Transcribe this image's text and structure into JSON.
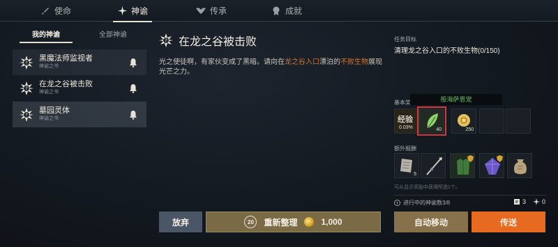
{
  "top_tabs": [
    {
      "label": "使命",
      "icon": "sword-icon"
    },
    {
      "label": "神谕",
      "icon": "compass-star-icon"
    },
    {
      "label": "传承",
      "icon": "wings-icon"
    },
    {
      "label": "成就",
      "icon": "medal-icon"
    }
  ],
  "sub_tabs": {
    "mine": "我的神谕",
    "all": "全部神谕"
  },
  "quests": [
    {
      "title": "黑魔法师监视者",
      "subtitle": "神谕之书"
    },
    {
      "title": "在龙之谷被击败",
      "subtitle": "神谕之书"
    },
    {
      "title": "墓园灵体",
      "subtitle": "神谕之书"
    }
  ],
  "main": {
    "title": "在龙之谷被击败",
    "desc_part1": "光之使徒啊，有家伙变成了黑暗。请向在",
    "desc_highlight1": "龙之谷入口",
    "desc_part2": "漂泊的",
    "desc_highlight2": "不败生物",
    "desc_part3": "展现光芒之力。"
  },
  "goal": {
    "label": "任务目标",
    "text": "清理龙之谷入口的不败生物(0/150)"
  },
  "rewards": {
    "basic_label": "基本奖",
    "tooltip": "般海萨恩宠",
    "exp_label": "经验",
    "exp_value": "0.03%",
    "item_count": "40",
    "gold_count": "250",
    "extra_label": "额外报酬",
    "extra_count": "5",
    "hint": "可从显示奖励中获得所选1个。"
  },
  "progress": {
    "text": "进行中的神谕数3/8",
    "count_a": "3",
    "count_b": "0"
  },
  "buttons": {
    "give_up": "放弃",
    "reset": "重新整理",
    "reset_badge": "20",
    "reset_cost": "1,000",
    "auto_move": "自动移动",
    "teleport": "传送"
  },
  "colors": {
    "highlight": "#d2762f",
    "teleport": "#e66a20",
    "tooltip_text": "#6fb86a",
    "selection_border": "#d6383a"
  }
}
